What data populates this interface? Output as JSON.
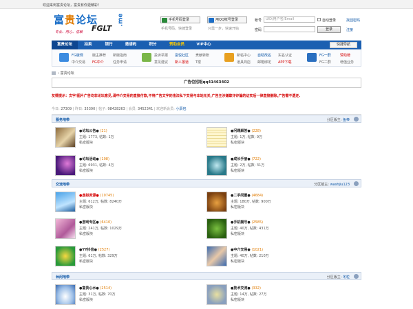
{
  "topbar": {
    "welcome": "欢迎来到富贵论坛，富贵有你更精彩！"
  },
  "logo": {
    "main_a": "富",
    "main_b": "贵",
    "main_c": "论坛",
    "fglt": "FGLT",
    "me": ".me",
    "slogan": "专业、用心、信赖"
  },
  "quick_login": {
    "phone_btn": "手机号码登录",
    "phone_sub": "手机号码，快捷登录",
    "qq_btn": "用QQ帐号登录",
    "qq_sub": "只需一步，快速开始"
  },
  "login": {
    "account_label": "帐号",
    "account_placeholder": "UID/用户名/Email",
    "auto_login": "自动登录",
    "forgot": "找回密码",
    "password_label": "密码",
    "login_btn": "登录",
    "register": "注册"
  },
  "nav": {
    "items": [
      "富贵论坛",
      "拍卖",
      "银行",
      "邀请码",
      "积分",
      "赞助会员",
      "VIP中心"
    ],
    "quick": "快捷导航"
  },
  "subnav": {
    "groups": [
      {
        "items": [
          "FG版规",
          "版主推荐",
          "新版指南",
          "中介交易",
          "FG中介",
          "任务申请"
        ]
      },
      {
        "items": [
          "投诉举报",
          "富悦社区",
          "贡献转账",
          "意见建议",
          "新人报道",
          "T楼"
        ]
      },
      {
        "items": [
          "新帖中心",
          "自助改名",
          "实名认证",
          "道具商店",
          "邮箱绑定",
          "APP下载"
        ]
      },
      {
        "items": [
          "FG一群",
          "赞助榜",
          "FG二群",
          "增值业务"
        ]
      }
    ]
  },
  "breadcrumb": {
    "current": "富贵论坛"
  },
  "ad": {
    "text": "广告位招租qq41463402"
  },
  "notice": {
    "text": "友情提示：文字/图片广告均非论坛意见,请中介交易的直接付款,不将广告文字的违法私下交易与本站无关,广告主涉嫌欺诈诈骗的证实后一律直接删除,广告需不遗还."
  },
  "stats": {
    "today_label": "今日:",
    "today": "27309",
    "yesterday_label": "昨日:",
    "yesterday": "35390",
    "posts_label": "帖子:",
    "posts": "98428263",
    "members_label": "会员:",
    "members": "3452341",
    "newest_label": "欢迎新会员:",
    "newest": "小辰包"
  },
  "sections": [
    {
      "title": "服务地带",
      "mod_label": "分区版主:",
      "mod": "鱼帝",
      "forums": [
        {
          "name": "●论坛公告●",
          "count": "(21)",
          "stats": "主题: 1773, 帖数: 1万",
          "priv": "私密版块"
        },
        {
          "name": "●问题解答●",
          "count": "(228)",
          "stats": "主题: 1万, 帖数: 9万",
          "priv": "私密版块"
        },
        {
          "name": "●论坛活动●",
          "count": "(198)",
          "stats": "主题: 6931, 帖数: 4万",
          "priv": "私密版块"
        },
        {
          "name": "●成长手册●",
          "count": "(722)",
          "stats": "主题: 2万, 帖数: 31万",
          "priv": "私密版块"
        }
      ]
    },
    {
      "title": "交流地带",
      "mod_label": "分区版主:",
      "mod": "washjiu123",
      "forums": [
        {
          "name": "●虚拟资源●",
          "count": "(10745)",
          "stats": "主题: 612万, 帖数: 8240万",
          "priv": "私密版块"
        },
        {
          "name": "●二手闲置●",
          "count": "(4684)",
          "stats": "主题: 180万, 帖数: 900万",
          "priv": "私密版块"
        },
        {
          "name": "●游戏专区●",
          "count": "(6410)",
          "stats": "主题: 241万, 帖数: 1029万",
          "priv": "私密版块"
        },
        {
          "name": "●手机靓号●",
          "count": "(2585)",
          "stats": "主题: 40万, 帖数: 431万",
          "priv": "私密版块"
        },
        {
          "name": "●YY抖音●",
          "count": "(2527)",
          "stats": "主题: 61万, 帖数: 329万",
          "priv": "私密版块"
        },
        {
          "name": "●中介交易●",
          "count": "(1021)",
          "stats": "主题: 40万, 帖数: 210万",
          "priv": "私密版块"
        }
      ]
    },
    {
      "title": "休闲地带",
      "mod_label": "分区版主:",
      "mod": "冬粒",
      "forums": [
        {
          "name": "●富贵心水●",
          "count": "(2514)",
          "stats": "主题: 31万, 帖数: 70万",
          "priv": "私密版块"
        },
        {
          "name": "●技术交流●",
          "count": "(332)",
          "stats": "主题: 14万, 帖数: 27万",
          "priv": "私密版块"
        }
      ]
    }
  ],
  "colors": {
    "nav_bg": "#1b5fb1",
    "accent": "#0b55a6",
    "notice": "#d40000",
    "count": "#e07b00"
  }
}
